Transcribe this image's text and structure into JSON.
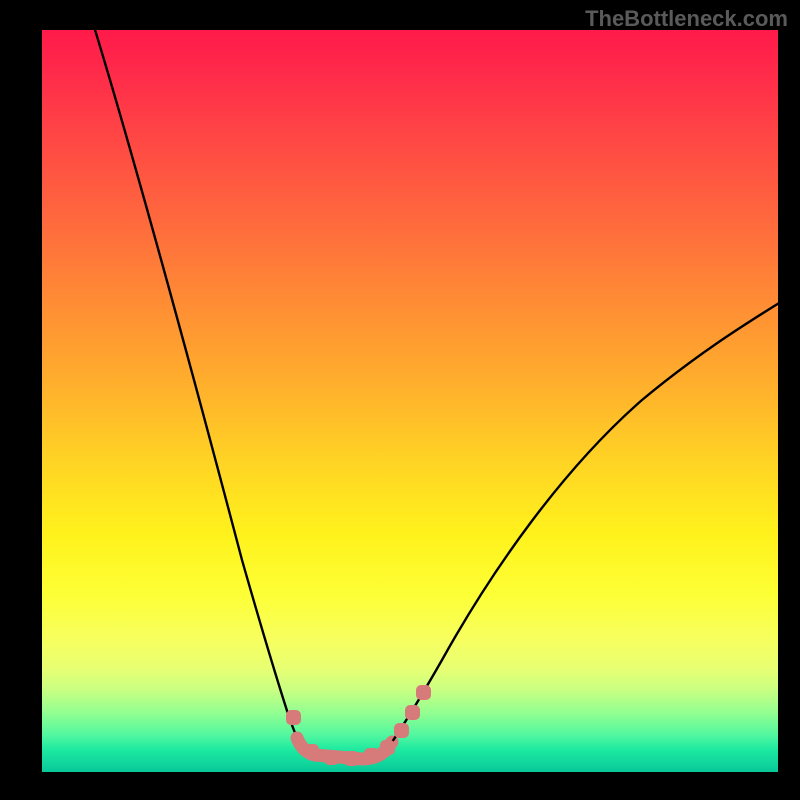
{
  "watermark": "TheBottleneck.com",
  "chart_data": {
    "type": "line",
    "title": "",
    "xlabel": "",
    "ylabel": "",
    "xlim": [
      0,
      736
    ],
    "ylim": [
      0,
      742
    ],
    "background": "vertical-gradient red-to-yellow-to-green",
    "series": [
      {
        "name": "bottleneck-curve",
        "description": "V-shaped curve descending steeply from upper-left, reaching a flat minimum segment highlighted with markers near the bottom, then rising gently to the right edge at mid-height",
        "color": "#000000"
      }
    ],
    "markers": {
      "color": "#d77a7a",
      "shape": "rounded-square",
      "count_left_branch": 1,
      "count_bottom_flat": 5,
      "count_right_branch": 3
    }
  }
}
